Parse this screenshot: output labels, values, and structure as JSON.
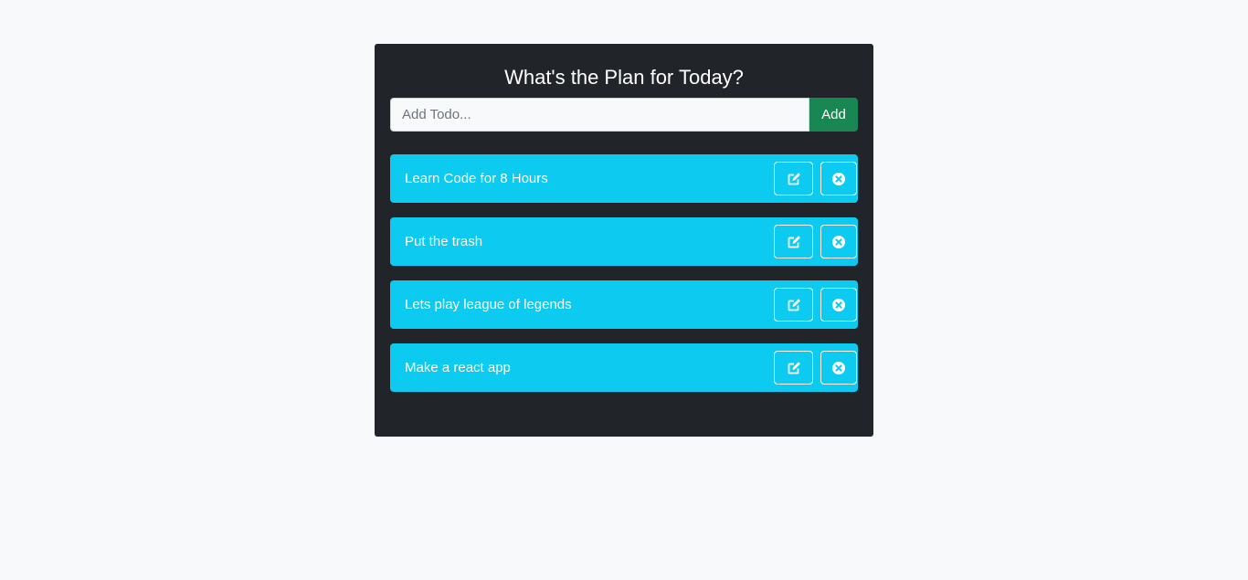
{
  "header": {
    "title": "What's the Plan for Today?"
  },
  "form": {
    "input_placeholder": "Add Todo...",
    "input_value": "",
    "add_label": "Add"
  },
  "todos": [
    {
      "text": "Learn Code for 8 Hours",
      "edit_icon": "edit-icon",
      "delete_icon": "close-circle-icon"
    },
    {
      "text": "Put the trash",
      "edit_icon": "edit-icon",
      "delete_icon": "close-circle-icon"
    },
    {
      "text": "Lets play league of legends",
      "edit_icon": "edit-icon",
      "delete_icon": "close-circle-icon"
    },
    {
      "text": "Make a react app",
      "edit_icon": "edit-icon",
      "delete_icon": "close-circle-icon"
    }
  ],
  "colors": {
    "page_background": "#f8f9fa",
    "card_background": "#212529",
    "add_button": "#198754",
    "todo_row": "#0dcaf0",
    "text_light": "#ffffff"
  }
}
